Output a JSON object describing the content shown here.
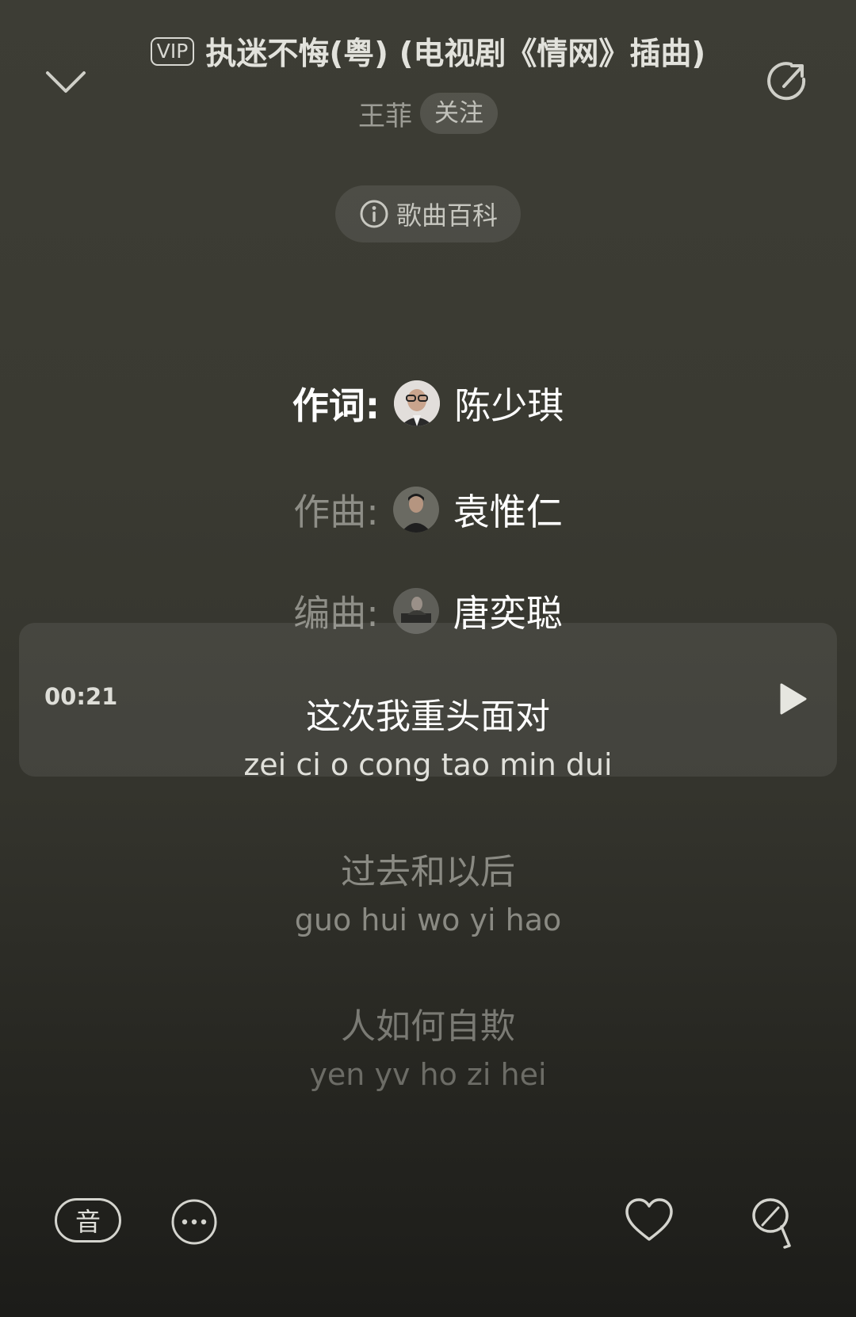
{
  "header": {
    "vip_badge": "VIP",
    "title": "执迷不悔(粤) (电视剧《情网》插曲)",
    "artist": "王菲",
    "follow_label": "关注",
    "encyclopedia_label": "歌曲百科"
  },
  "credits": [
    {
      "role": "作词:",
      "name": "陈少琪"
    },
    {
      "role": "作曲:",
      "name": "袁惟仁"
    },
    {
      "role": "编曲:",
      "name": "唐奕聪"
    }
  ],
  "current_line": {
    "timestamp": "00:21",
    "chinese": "这次我重头面对",
    "pinyin": "zei ci o cong tao min dui"
  },
  "lyrics": [
    {
      "chinese": "过去和以后",
      "pinyin": "guo hui wo yi hao"
    },
    {
      "chinese": "人如何自欺",
      "pinyin": "yen yv ho zi hei"
    }
  ],
  "bottom_bar": {
    "sound_label": "音"
  },
  "icons": {
    "collapse": "chevron-down-icon",
    "share": "share-icon",
    "info": "info-icon",
    "play": "play-icon",
    "more": "more-icon",
    "like": "heart-icon",
    "comment": "comment-icon"
  },
  "colors": {
    "background_top": "#3d3d35",
    "background_bottom": "#1c1c19",
    "highlight_text": "#ffffff",
    "dim_text": "#8e8e87"
  }
}
